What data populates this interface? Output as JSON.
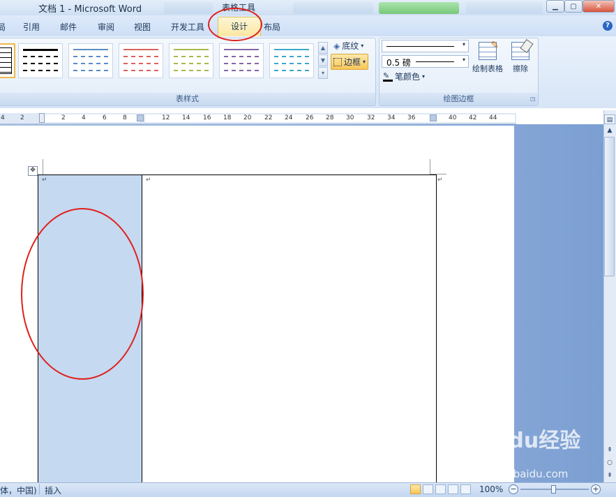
{
  "window": {
    "title": "文档 1 - Microsoft Word",
    "context_tab_title": "表格工具",
    "help_label": "?"
  },
  "tabs": [
    "局",
    "引用",
    "邮件",
    "审阅",
    "视图",
    "开发工具",
    "设计",
    "布局"
  ],
  "active_tab": "设计",
  "ribbon": {
    "table_styles": {
      "group_title": "表样式",
      "shading_label": "底纹",
      "borders_label": "边框",
      "tile_colors": [
        "#000000",
        "#5b8bc7",
        "#d9625f",
        "#a6b94b",
        "#8466a6",
        "#3aa7c7"
      ]
    },
    "draw_borders": {
      "group_title": "绘图边框",
      "weight_label": "0.5 磅",
      "pen_color_label": "笔颜色",
      "draw_table_label": "绘制表格",
      "eraser_label": "擦除"
    }
  },
  "ruler": {
    "numbers": [
      "4",
      "2",
      "2",
      "4",
      "6",
      "8",
      "12",
      "14",
      "16",
      "18",
      "20",
      "22",
      "24",
      "26",
      "28",
      "30",
      "32",
      "34",
      "36",
      "40",
      "42",
      "44"
    ]
  },
  "document": {
    "paragraph_mark": "↵"
  },
  "status_bar": {
    "language": "体，中国)",
    "mode": "插入",
    "zoom": "100%"
  },
  "annotations": {
    "color": "#e0201c"
  },
  "watermark": {
    "text": "Baidu经验",
    "url": "jingyan.baidu.com"
  }
}
